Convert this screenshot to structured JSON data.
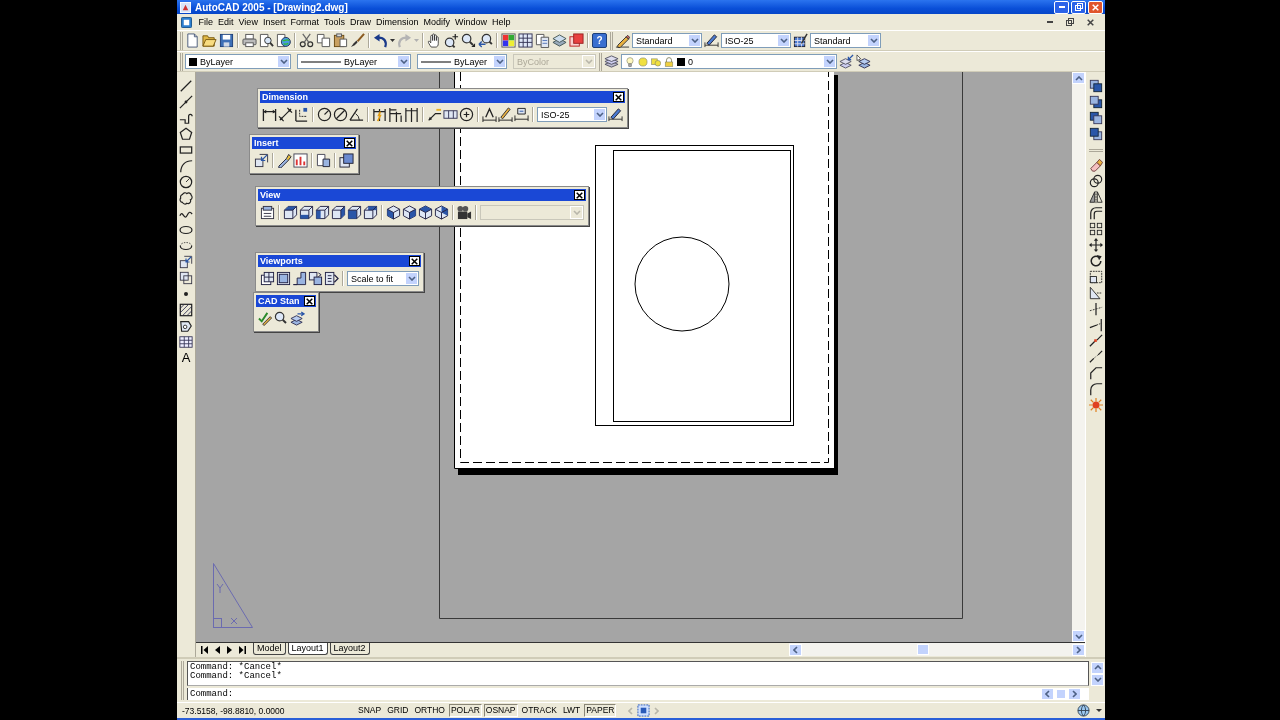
{
  "window": {
    "title": "AutoCAD 2005 - [Drawing2.dwg]"
  },
  "menu_bar": [
    "File",
    "Edit",
    "View",
    "Insert",
    "Format",
    "Tools",
    "Draw",
    "Dimension",
    "Modify",
    "Window",
    "Help"
  ],
  "standard_toolbar": {
    "redo": {
      "disabled": true
    },
    "help_button": "?"
  },
  "styles_toolbar": {
    "text_style": "Standard",
    "dimension_style": "ISO-25",
    "table_style": "Standard"
  },
  "properties_toolbar": [
    {
      "kind": "color",
      "value": "ByLayer",
      "disabled": false
    },
    {
      "kind": "linetype",
      "value": "ByLayer",
      "disabled": false
    },
    {
      "kind": "lineweight",
      "value": "ByLayer",
      "disabled": false
    },
    {
      "kind": "plot_style",
      "value": "ByColor",
      "disabled": true
    }
  ],
  "layers_toolbar": {
    "layer": "0"
  },
  "draw_toolbar": {
    "text_button": "A"
  },
  "floating_toolbars": [
    {
      "kind": "dimension",
      "title": "Dimension",
      "dropdown": {
        "value": "ISO-25",
        "disabled": false
      }
    },
    {
      "kind": "insert",
      "title": "Insert"
    },
    {
      "kind": "view",
      "title": "View",
      "dropdown": {
        "disabled": true
      }
    },
    {
      "kind": "viewports",
      "title": "Viewports",
      "dropdown": {
        "value": "Scale to fit",
        "disabled": false
      }
    },
    {
      "kind": "cad_standards",
      "title": "CAD Stan"
    }
  ],
  "layout_tabs": [
    {
      "label": "Model",
      "selected": false
    },
    {
      "label": "Layout1",
      "selected": true
    },
    {
      "label": "Layout2",
      "selected": false
    }
  ],
  "command_window": {
    "history": [
      "Command: *Cancel*",
      "Command: *Cancel*"
    ],
    "prompt": "Command:"
  },
  "status_bar": {
    "coordinates": "-73.5158, -98.8810, 0.0000",
    "toggles": [
      {
        "label": "SNAP",
        "on": false
      },
      {
        "label": "GRID",
        "on": false
      },
      {
        "label": "ORTHO",
        "on": false
      },
      {
        "label": "POLAR",
        "on": true
      },
      {
        "label": "OSNAP",
        "on": true
      },
      {
        "label": "OTRACK",
        "on": false
      },
      {
        "label": "LWT",
        "on": false
      },
      {
        "label": "PAPER",
        "on": true
      }
    ]
  }
}
